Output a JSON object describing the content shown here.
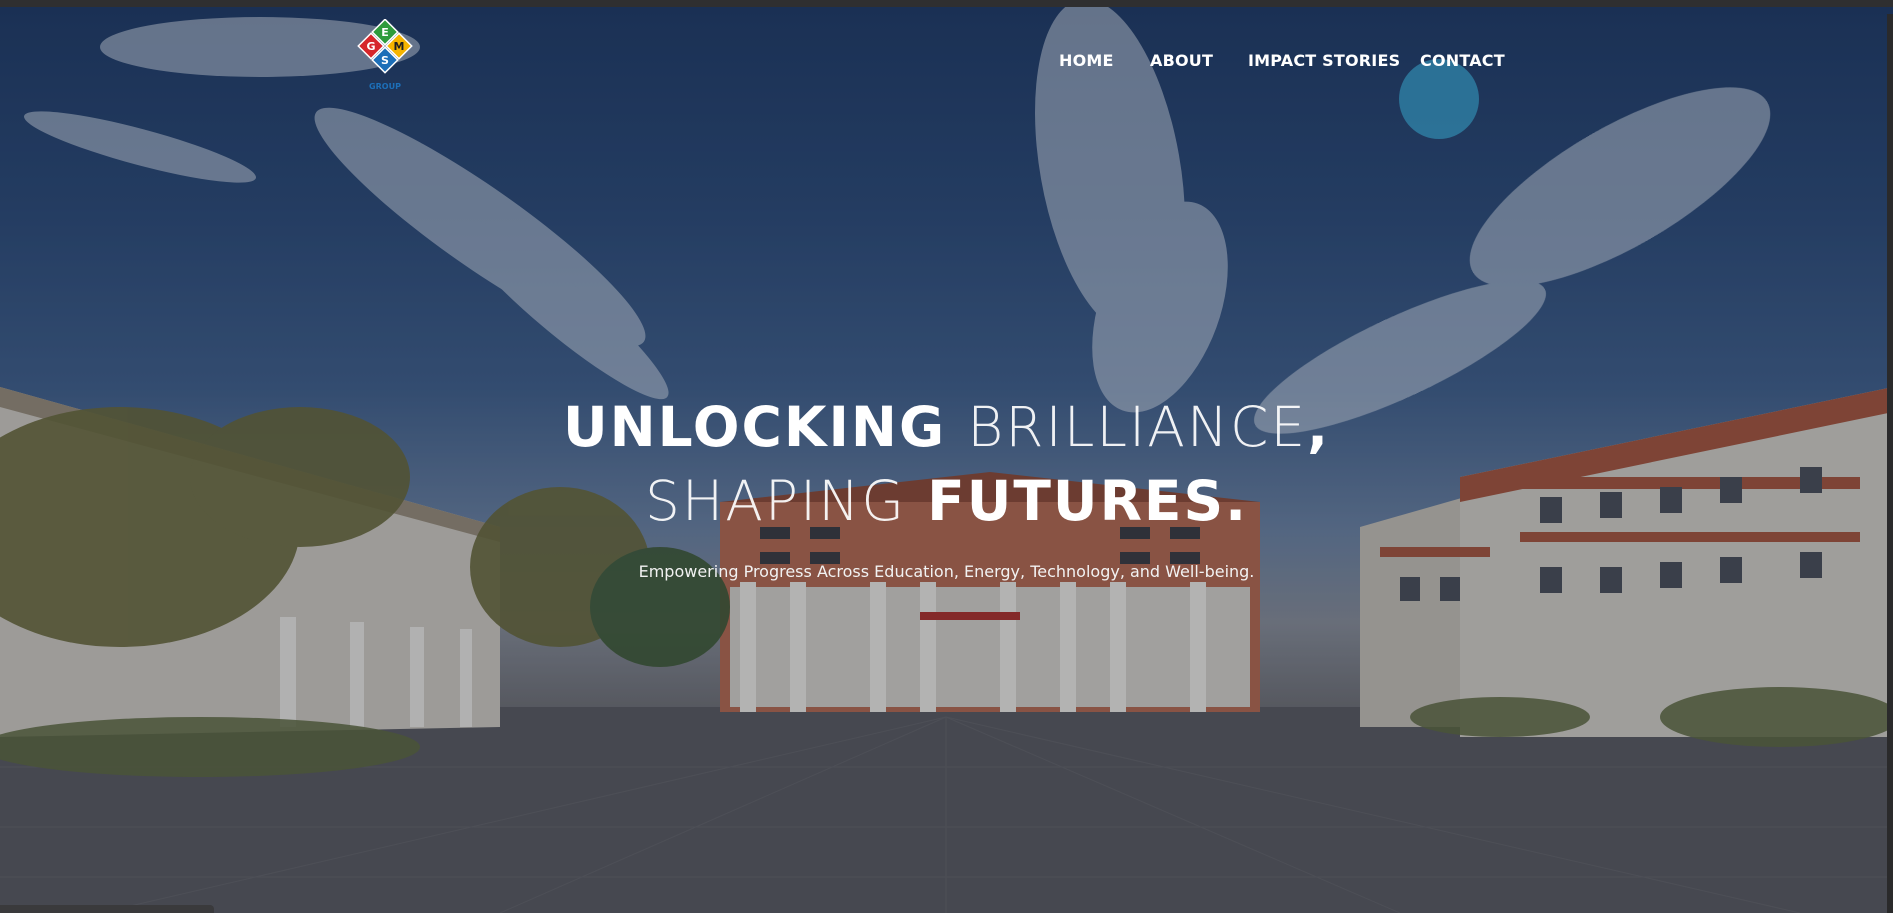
{
  "brand": {
    "logo_letters": [
      "E",
      "G",
      "M",
      "S"
    ],
    "logo_caption": "GROUP",
    "logo_colors": [
      "#2e9b3c",
      "#d6262b",
      "#f5b400",
      "#1d6fb8"
    ]
  },
  "nav": {
    "items": [
      {
        "label": "HOME"
      },
      {
        "label": "ABOUT"
      },
      {
        "label": "IMPACT STORIES"
      },
      {
        "label": "CONTACT",
        "active": true
      }
    ],
    "active_color": "#2f7fa3"
  },
  "hero": {
    "line1_bold": "UNLOCKING",
    "line1_thin": "BRILLIANCE",
    "line1_comma": ",",
    "line2_thin": "SHAPING",
    "line2_bold": "FUTURES.",
    "subtitle": "Empowering Progress Across Education, Energy, Technology, and Well-being."
  },
  "background": {
    "description_icon": "campus-photo",
    "sky_color": "#2b4a78",
    "brick_color": "#b86a4f"
  }
}
